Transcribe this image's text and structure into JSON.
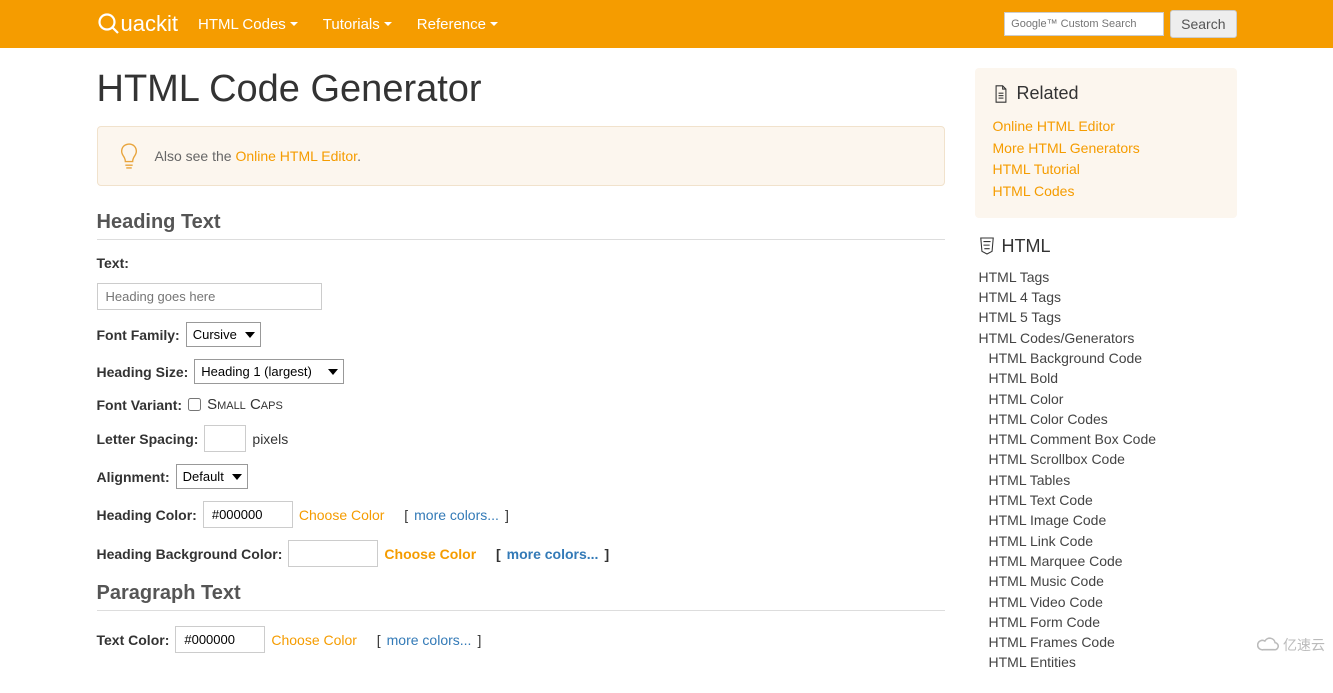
{
  "brand": "uackit",
  "nav": [
    {
      "label": "HTML Codes",
      "dd": true
    },
    {
      "label": "Tutorials",
      "dd": true
    },
    {
      "label": "Reference",
      "dd": true
    }
  ],
  "search": {
    "placeholder": "Google™ Custom Search",
    "button": "Search"
  },
  "page_title": "HTML Code Generator",
  "callout": {
    "prefix": "Also see the ",
    "link": "Online HTML Editor",
    "suffix": "."
  },
  "sections": {
    "heading": {
      "title": "Heading Text"
    },
    "paragraph": {
      "title": "Paragraph Text"
    }
  },
  "form": {
    "text_label": "Text:",
    "text_placeholder": "Heading goes here",
    "font_family_label": "Font Family:",
    "font_family_value": "Cursive",
    "heading_size_label": "Heading Size:",
    "heading_size_value": "Heading 1 (largest)",
    "font_variant_label": "Font Variant:",
    "small_caps": "Small Caps",
    "letter_spacing_label": "Letter Spacing:",
    "pixels": "pixels",
    "alignment_label": "Alignment:",
    "alignment_value": "Default",
    "heading_color_label": "Heading Color:",
    "heading_color_value": "#000000",
    "heading_bg_label": "Heading Background Color:",
    "choose": "Choose Color",
    "more": "more colors...",
    "text_color_label": "Text Color:",
    "text_color_value": "#000000"
  },
  "related": {
    "title": "Related",
    "links": [
      "Online HTML Editor",
      "More HTML Generators",
      "HTML Tutorial",
      "HTML Codes"
    ]
  },
  "sidebar": {
    "title": "HTML",
    "links": [
      {
        "t": "HTML Tags"
      },
      {
        "t": "HTML 4 Tags"
      },
      {
        "t": "HTML 5 Tags"
      },
      {
        "t": "HTML Codes/Generators"
      },
      {
        "t": "HTML Background Code",
        "i": 1
      },
      {
        "t": "HTML Bold",
        "i": 1
      },
      {
        "t": "HTML Color",
        "i": 1
      },
      {
        "t": "HTML Color Codes",
        "i": 1
      },
      {
        "t": "HTML Comment Box Code",
        "i": 1
      },
      {
        "t": "HTML Scrollbox Code",
        "i": 1
      },
      {
        "t": "HTML Tables",
        "i": 1
      },
      {
        "t": "HTML Text Code",
        "i": 1
      },
      {
        "t": "HTML Image Code",
        "i": 1
      },
      {
        "t": "HTML Link Code",
        "i": 1
      },
      {
        "t": "HTML Marquee Code",
        "i": 1
      },
      {
        "t": "HTML Music Code",
        "i": 1
      },
      {
        "t": "HTML Video Code",
        "i": 1
      },
      {
        "t": "HTML Form Code",
        "i": 1
      },
      {
        "t": "HTML Frames Code",
        "i": 1
      },
      {
        "t": "HTML Entities",
        "i": 1
      }
    ]
  },
  "watermark": "亿速云"
}
